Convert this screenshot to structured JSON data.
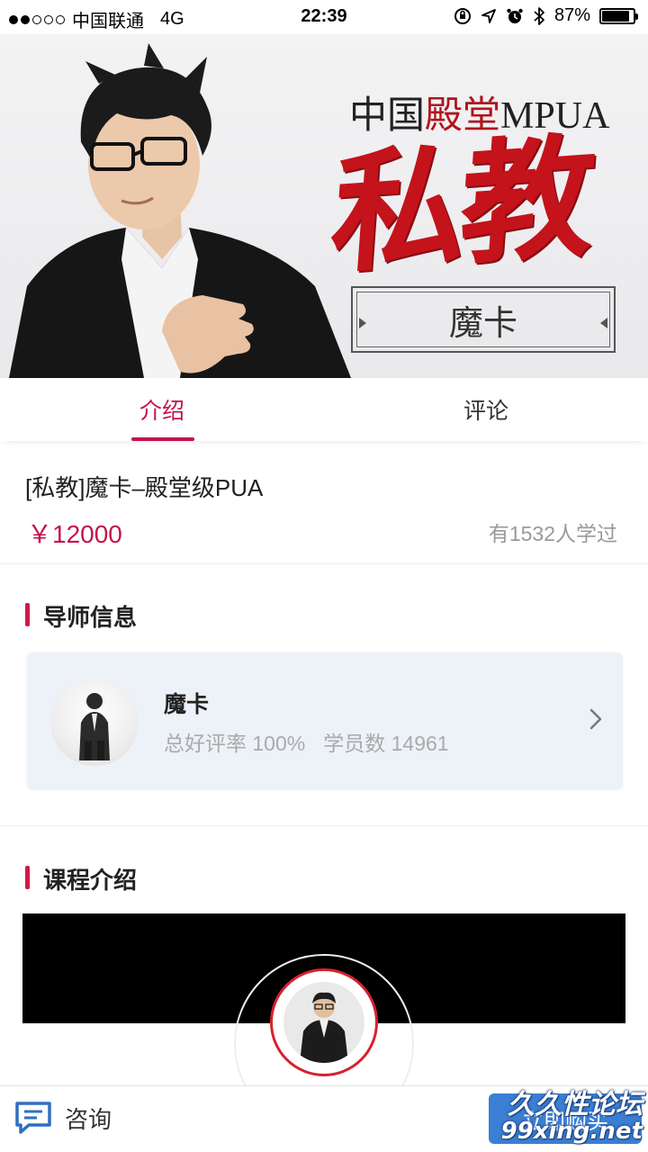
{
  "status_bar": {
    "carrier": "中国联通",
    "network": "4G",
    "time": "22:39",
    "battery": "87%",
    "battery_level": 0.87
  },
  "banner": {
    "title_black1": "中国",
    "title_red": "殿堂",
    "title_black2": "MPUA",
    "big_text": "私教",
    "name": "魔卡"
  },
  "tabs": [
    {
      "label": "介绍",
      "active": true
    },
    {
      "label": "评论",
      "active": false
    }
  ],
  "course": {
    "title": "[私教]魔卡–殿堂级PUA",
    "price": "￥12000",
    "learners": "有1532人学过"
  },
  "mentor_section": {
    "title": "导师信息",
    "name": "魔卡",
    "rating": "总好评率 100%",
    "students": "学员数 14961"
  },
  "intro_section": {
    "title": "课程介绍"
  },
  "bottom_bar": {
    "consult": "咨询",
    "buy": "立即购买"
  },
  "watermark": {
    "line1": "久久性论坛",
    "line2": "99xing.net"
  },
  "colors": {
    "accent": "#c4144b",
    "banner_red": "#c4131b",
    "card_bg": "#edf1f8",
    "buy_button": "#3a7fd3"
  },
  "icons": [
    "signal-dots-icon",
    "orientation-lock-icon",
    "location-icon",
    "alarm-icon",
    "bluetooth-icon",
    "battery-icon",
    "chevron-right-icon",
    "chat-icon"
  ]
}
